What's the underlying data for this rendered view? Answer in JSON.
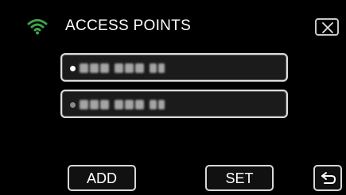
{
  "header": {
    "title": "ACCESS POINTS",
    "wifi_icon": "wifi-icon",
    "close_icon": "close-icon"
  },
  "access_points": [
    {
      "label": "",
      "selected": true,
      "dot_color": "#ffffff"
    },
    {
      "label": "",
      "selected": false,
      "dot_color": "#8a8a8a"
    }
  ],
  "buttons": {
    "add_label": "ADD",
    "set_label": "SET",
    "back_icon": "return-icon"
  },
  "colors": {
    "background": "#000000",
    "wifi": "#3fa34d",
    "border": "#dcdcdc"
  }
}
